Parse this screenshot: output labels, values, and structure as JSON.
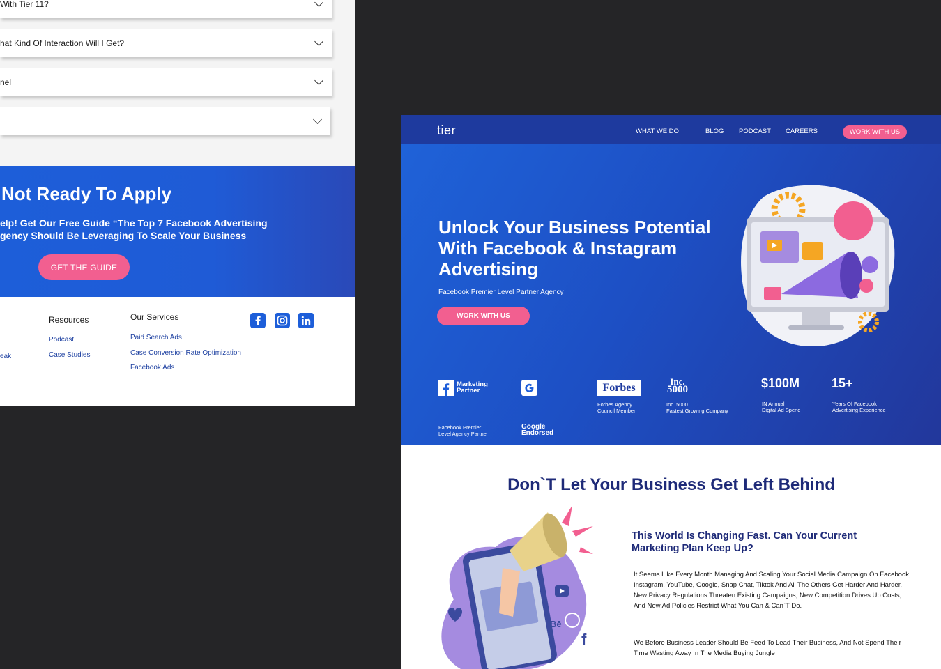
{
  "faq": {
    "items": [
      {
        "question": "With Tier 11?"
      },
      {
        "question": "hat Kind Of Interaction Will I Get?"
      },
      {
        "question": "nel"
      },
      {
        "question": ""
      }
    ]
  },
  "cta": {
    "title": "Not Ready To Apply",
    "line1": "elp! Get Our Free Guide “The Top 7 Facebook Advertising",
    "line2": "gency Should Be Leveraging To Scale Your Business",
    "button": "GET THE GUIDE"
  },
  "footer": {
    "partial_link": "eak",
    "resources": {
      "heading": "Resources",
      "links": [
        "Podcast",
        "Case Studies"
      ]
    },
    "services": {
      "heading": "Our Services",
      "links": [
        "Paid Search Ads",
        "Case Conversion Rate Optimization",
        "Facebook Ads"
      ]
    },
    "social_icons": [
      "facebook-icon",
      "instagram-icon",
      "linkedin-icon"
    ]
  },
  "site": {
    "logo": "tier",
    "nav": [
      "WHAT WE DO",
      "BLOG",
      "PODCAST",
      "CAREERS"
    ],
    "nav_cta": "WORK  WITH US"
  },
  "hero": {
    "title": "Unlock Your Business Potential With Facebook & Instagram Advertising",
    "subtitle": "Facebook Premier Level Partner Agency",
    "button": "WORK WITH US"
  },
  "badges": {
    "fb_label1": "Marketing",
    "fb_label2": "Partner",
    "fb_cap1": "Facebook Premier",
    "fb_cap2": "Level Agency Partner",
    "google_cap1": "Google",
    "google_cap2": "Endorsed",
    "forbes_logo": "Forbes",
    "forbes_cap1": "Forbes Agency",
    "forbes_cap2": "Council Member",
    "inc_logo1": "Inc.",
    "inc_logo2": "5000",
    "inc_cap1": "Inc. 5000",
    "inc_cap2": "Fastest Growing Company",
    "stat1_value": "$100M",
    "stat1_cap1": "IN Annual",
    "stat1_cap2": "Digital Ad Spend",
    "stat2_value": "15+",
    "stat2_cap1": "Years Of Facebook",
    "stat2_cap2": "Advertising Experience"
  },
  "section": {
    "title": "Don`T  Let Your Business Get Left Behind",
    "subtitle": "This World Is Changing Fast. Can Your Current Marketing Plan Keep Up?",
    "p1": "It Seems Like Every Month Managing And Scaling Your Social Media Campaign On Facebook, Instagram, YouTube, Google, Snap Chat, Tiktok And All The Others Get Harder And Harder. New Privacy Regulations Threaten Existing Campaigns, New Competition Drives Up Costs, And New Ad Policies Restrict What You Can & Can`T Do.",
    "p2": "We Before Business Leader Should Be Feed To Lead Their Business, And Not Spend Their Time Wasting Away In The Media Buying Jungle"
  },
  "colors": {
    "brand_blue": "#1d5ed9",
    "navy": "#1e2a78",
    "pink": "#f25f90",
    "page_bg": "#252527"
  }
}
